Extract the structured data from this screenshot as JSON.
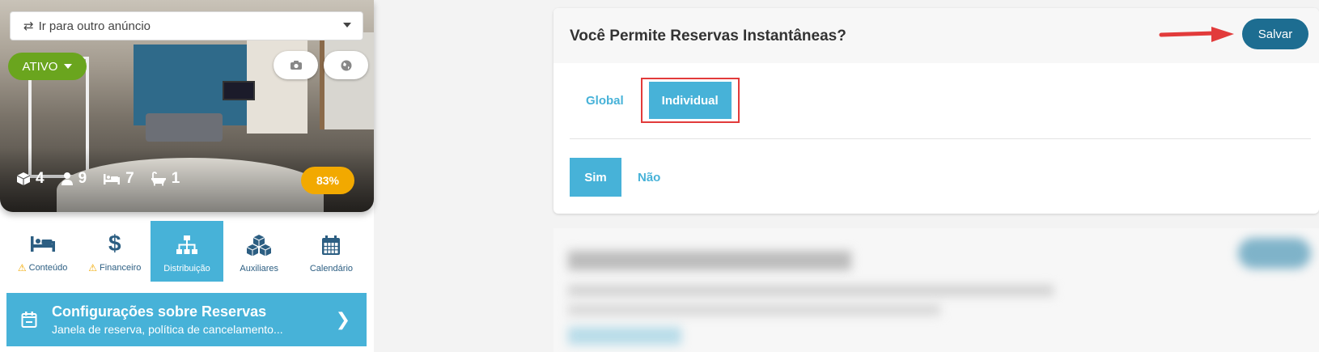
{
  "listing": {
    "goto_label": "Ir para outro anúncio",
    "status_label": "ATIVO",
    "stats": {
      "units": "4",
      "guests": "9",
      "beds": "7",
      "baths": "1"
    },
    "completion": "83%"
  },
  "tabs": [
    {
      "label": "Conteúdo",
      "warning": true
    },
    {
      "label": "Financeiro",
      "warning": true
    },
    {
      "label": "Distribuição",
      "active": true
    },
    {
      "label": "Auxiliares"
    },
    {
      "label": "Calendário"
    }
  ],
  "config_card": {
    "title": "Configurações sobre Reservas",
    "subtitle": "Janela de reserva, política de cancelamento..."
  },
  "instant_booking": {
    "title": "Você Permite Reservas Instantâneas?",
    "save_label": "Salvar",
    "modes": {
      "global": "Global",
      "individual": "Individual"
    },
    "options": {
      "yes": "Sim",
      "no": "Não"
    }
  },
  "colors": {
    "accent": "#47b2d8",
    "save": "#1d6d91",
    "active_status": "#6aa51e",
    "completion": "#f2a900",
    "highlight": "#e23b3b"
  }
}
